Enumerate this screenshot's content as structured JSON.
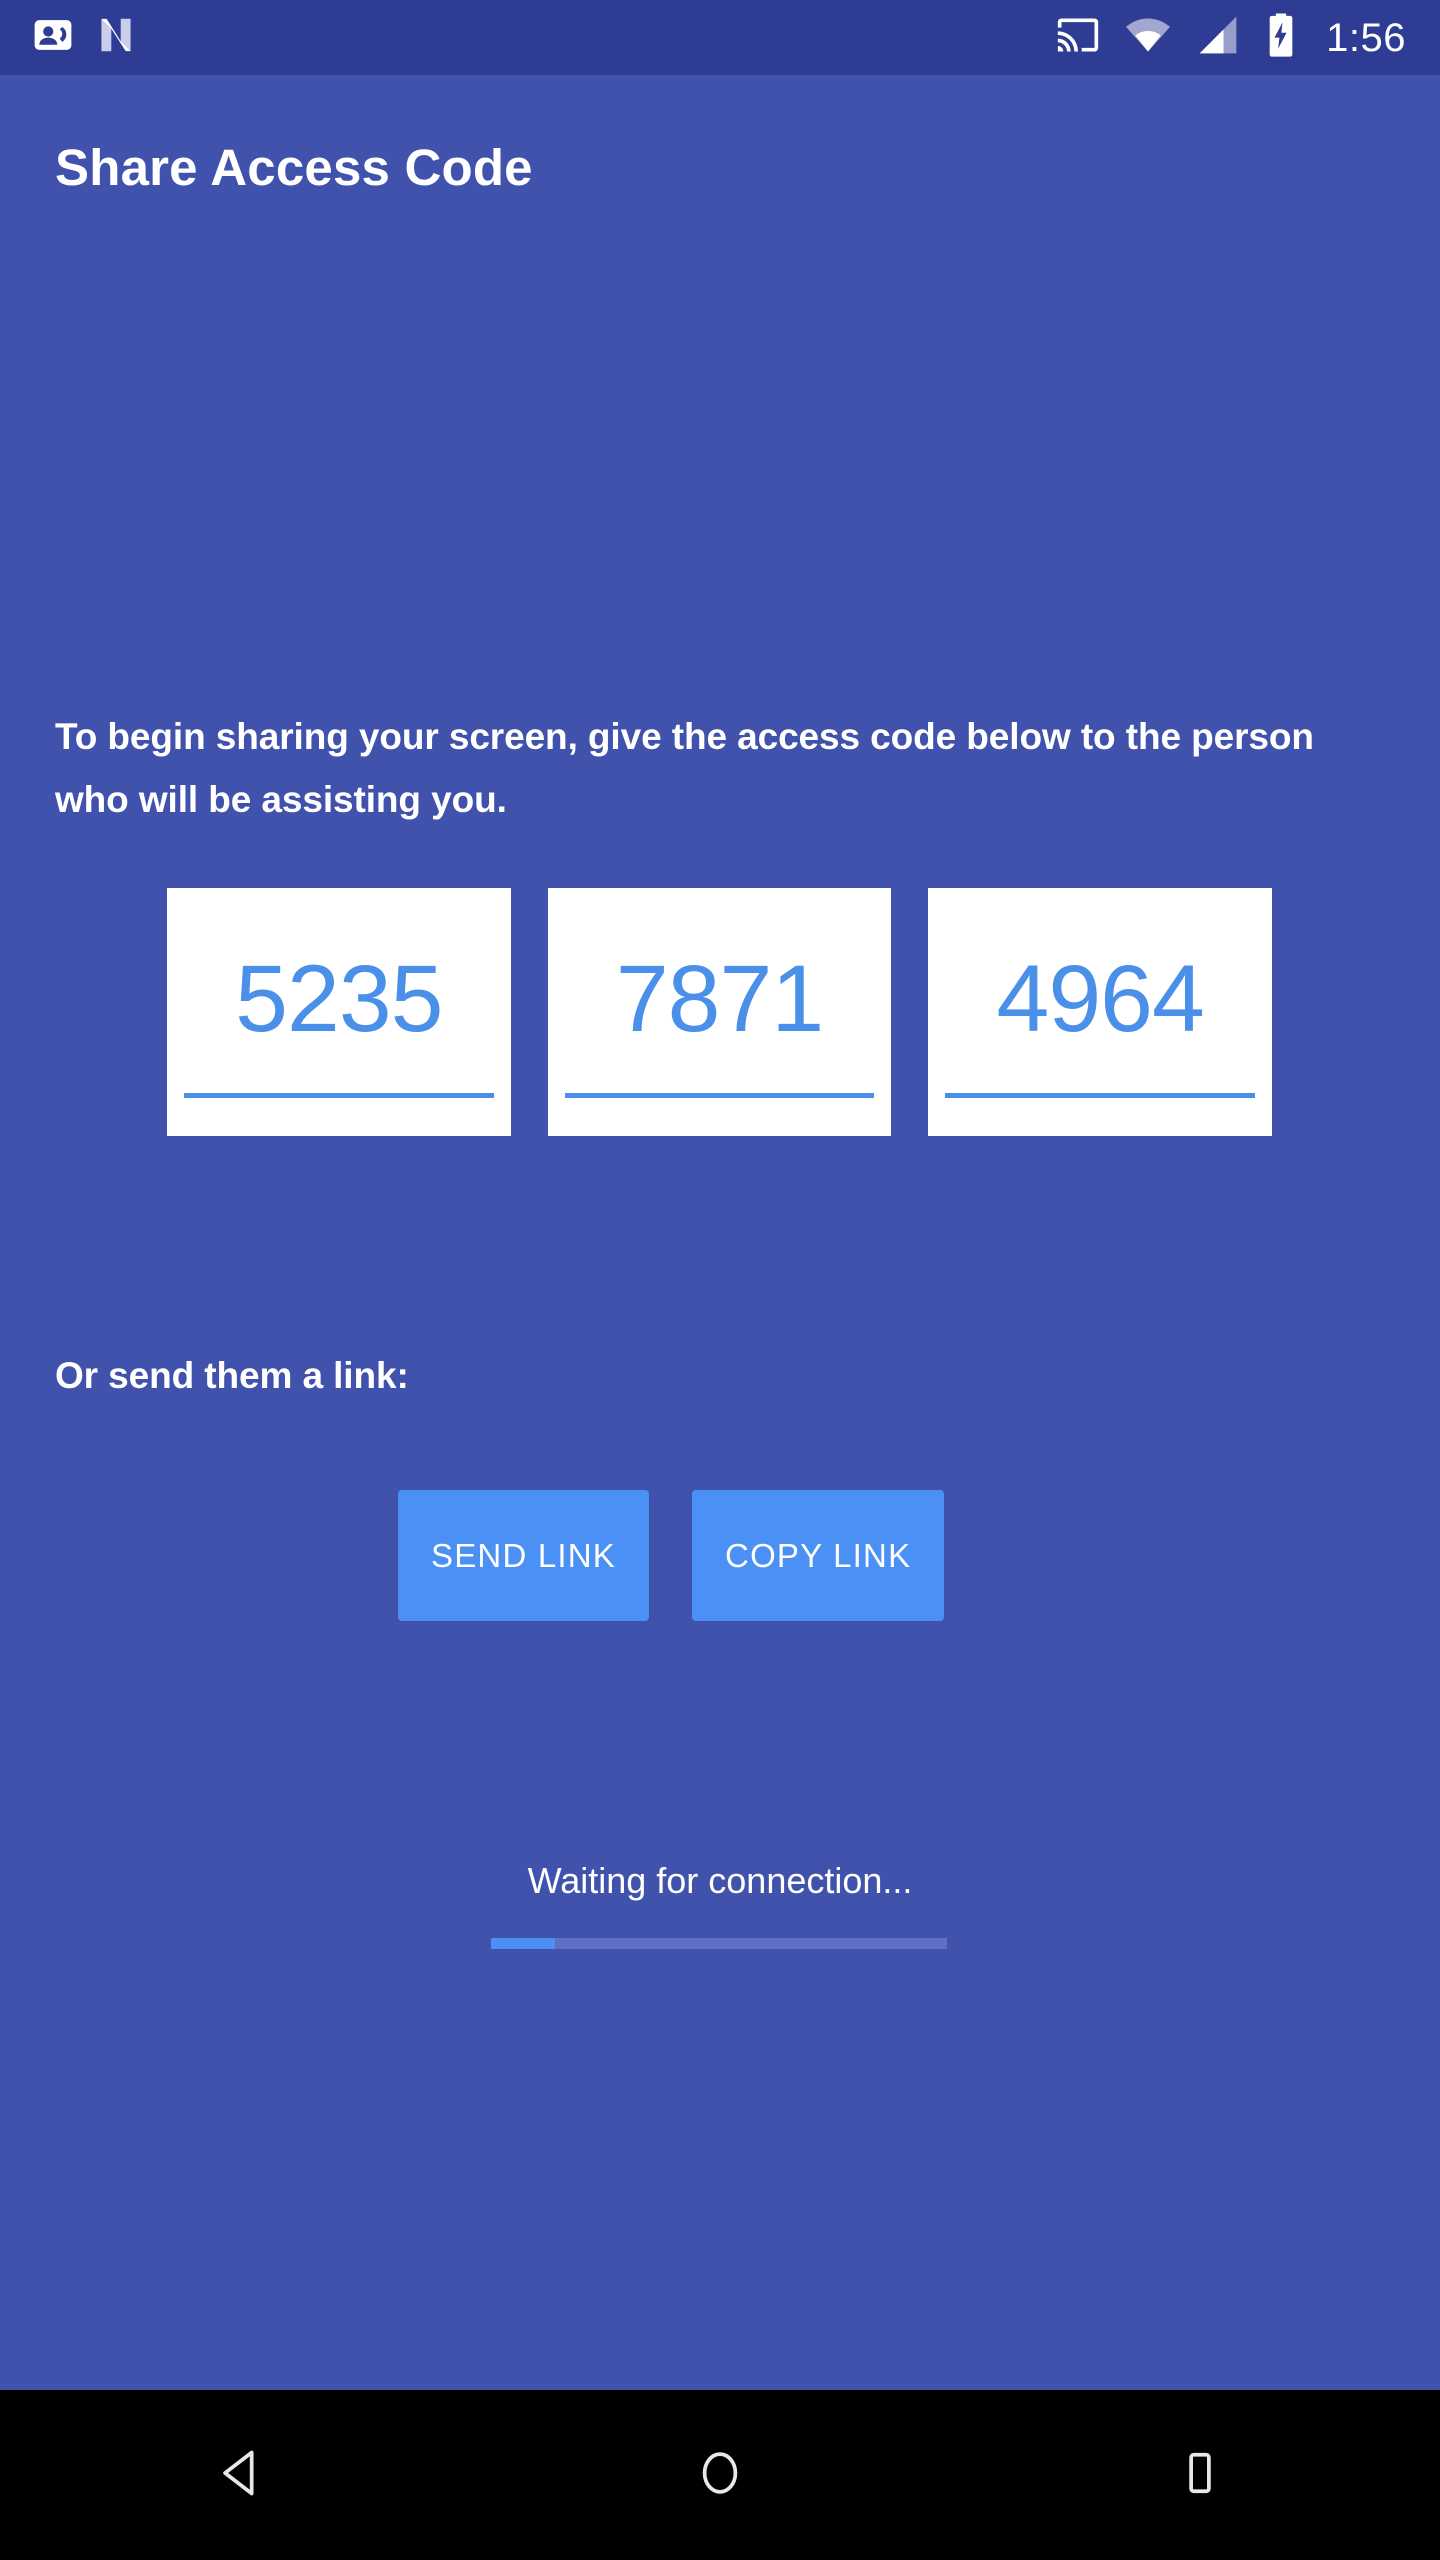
{
  "status_bar": {
    "background_color": "#2F3C93",
    "left_icons": [
      {
        "name": "contacts-badge-icon",
        "label": "Contacts"
      },
      {
        "name": "android-nougat-icon",
        "label": "N"
      }
    ],
    "right_icons": [
      {
        "name": "cast-icon",
        "label": "Cast"
      },
      {
        "name": "wifi-icon",
        "label": "Wi-Fi"
      },
      {
        "name": "cellular-signal-icon",
        "label": "Signal"
      },
      {
        "name": "battery-charging-icon",
        "label": "Battery charging"
      }
    ],
    "clock": "1:56"
  },
  "screen": {
    "background_color": "#4152AC",
    "title": "Share Access Code",
    "instructions": "To begin sharing your screen, give the access code below to the person who will be assisting you."
  },
  "access_code": {
    "accent_color": "#4A90E8",
    "box_background": "#FFFFFF",
    "groups": [
      {
        "value": "5235"
      },
      {
        "value": "7871"
      },
      {
        "value": "4964"
      }
    ],
    "full_code": "5235 7871 4964"
  },
  "link_section": {
    "label": "Or send them a link:",
    "button_color": "#4A90F5",
    "buttons": [
      {
        "name": "send-link-button",
        "label": "SEND LINK"
      },
      {
        "name": "copy-link-button",
        "label": "COPY LINK"
      }
    ]
  },
  "connection_status": {
    "text": "Waiting for connection...",
    "progress_percent": 14,
    "progress_fill_color": "#4A90F5",
    "progress_track_color": "#5E6FC4"
  },
  "nav_bar": {
    "background_color": "#000000",
    "buttons": [
      {
        "name": "nav-back-button",
        "label": "Back"
      },
      {
        "name": "nav-home-button",
        "label": "Home"
      },
      {
        "name": "nav-recents-button",
        "label": "Recents"
      }
    ]
  }
}
